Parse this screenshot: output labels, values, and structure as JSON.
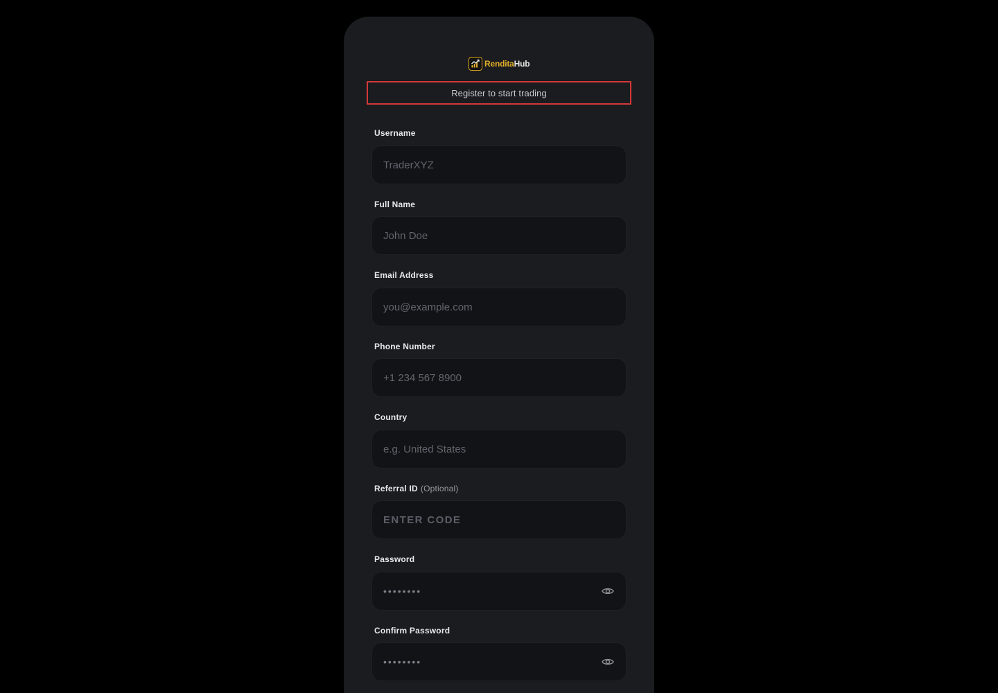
{
  "colors": {
    "background": "#000000",
    "card": "#1b1c1f",
    "input": "#121317",
    "accent_gold": "#e0ad28",
    "highlight_border": "#d3383a"
  },
  "brand": {
    "logo_icon": "trend-chart-icon",
    "name_part1": "Rendita",
    "name_part2": "Hub"
  },
  "header": {
    "subtitle": "Register to start trading"
  },
  "form": {
    "username": {
      "label": "Username",
      "placeholder": "TraderXYZ"
    },
    "full_name": {
      "label": "Full Name",
      "placeholder": "John Doe"
    },
    "email": {
      "label": "Email Address",
      "placeholder": "you@example.com"
    },
    "phone": {
      "label": "Phone Number",
      "placeholder": "+1 234 567 8900"
    },
    "country": {
      "label": "Country",
      "placeholder": "e.g. United States"
    },
    "referral": {
      "label": "Referral ID",
      "optional": "(Optional)",
      "placeholder": "ENTER CODE"
    },
    "password": {
      "label": "Password",
      "value": "••••••••",
      "toggle_icon": "eye-icon"
    },
    "confirm_password": {
      "label": "Confirm Password",
      "value": "••••••••",
      "toggle_icon": "eye-icon"
    }
  }
}
